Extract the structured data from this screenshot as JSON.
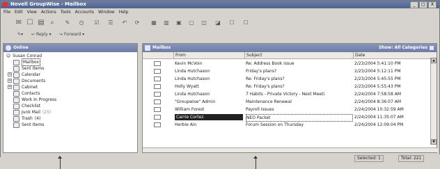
{
  "window": {
    "title": "Novell GroupWise - Mailbox",
    "controls": [
      "_",
      "□",
      "X"
    ]
  },
  "menu": [
    "File",
    "Edit",
    "View",
    "Actions",
    "Tools",
    "Accounts",
    "Window",
    "Help"
  ],
  "toolbar2": {
    "reply": "Reply",
    "forward": "Forward"
  },
  "left_panel": {
    "title": "Online",
    "user": "Susan Conrad",
    "items": [
      {
        "label": "Mailbox",
        "selected": true,
        "icon": "mailbox-icon"
      },
      {
        "label": "Sent Items",
        "icon": "sent-items-icon"
      },
      {
        "label": "Calendar",
        "icon": "calendar-icon"
      },
      {
        "label": "Documents",
        "icon": "documents-icon"
      },
      {
        "label": "Cabinet",
        "icon": "cabinet-icon"
      },
      {
        "label": "Contacts",
        "icon": "contacts-icon"
      },
      {
        "label": "Work In Progress",
        "icon": "work-in-progress-icon"
      },
      {
        "label": "Checklist",
        "icon": "checklist-icon"
      },
      {
        "label": "Junk Mail",
        "count": "(25)",
        "icon": "junk-mail-icon"
      },
      {
        "label": "Trash",
        "count": "(4)",
        "icon": "trash-icon"
      },
      {
        "label": "Sent Items",
        "icon": "sent-icon"
      }
    ]
  },
  "right_panel": {
    "title": "Mailbox",
    "filter": "Show: All Categories",
    "columns": [
      "From",
      "Subject",
      "Date"
    ],
    "rows": [
      {
        "from": "Kevin McVoin",
        "subject": "Re: Address Book issue",
        "date": "2/23/2004 5:41:10 PM"
      },
      {
        "from": "Linda Hutchason",
        "subject": "Friday's plans?",
        "date": "2/23/2004 5:12:11 PM"
      },
      {
        "from": "Linda Hutchason",
        "subject": "Re: Friday's plans?",
        "date": "2/23/2004 5:45:55 PM"
      },
      {
        "from": "Holly Wyatt",
        "subject": "Re: Friday's plans?",
        "date": "2/23/2004 5:55:43 PM"
      },
      {
        "from": "Linda Hutchason",
        "subject": "7 Habits - Private Victory - Next Meeti",
        "date": "2/24/2004 7:58:58 AM"
      },
      {
        "from": "\"Groupwise\" Admin",
        "subject": "Maintenance Renewal",
        "date": "2/24/2004 8:36:07 AM"
      },
      {
        "from": "William Forest",
        "subject": "Payroll Issues",
        "date": "2/24/2004 10:32:59 AM"
      },
      {
        "from": "Carrie Cortez",
        "subject": "NEO Packet",
        "date": "2/24/2004 11:35:07 AM",
        "highlight": true
      },
      {
        "from": "Herbie Ain",
        "subject": "Forum Session on Thursday",
        "date": "2/24/2004 12:09:04 PM"
      }
    ]
  },
  "status": {
    "selected": "Selected: 1",
    "total": "Total: 221"
  }
}
